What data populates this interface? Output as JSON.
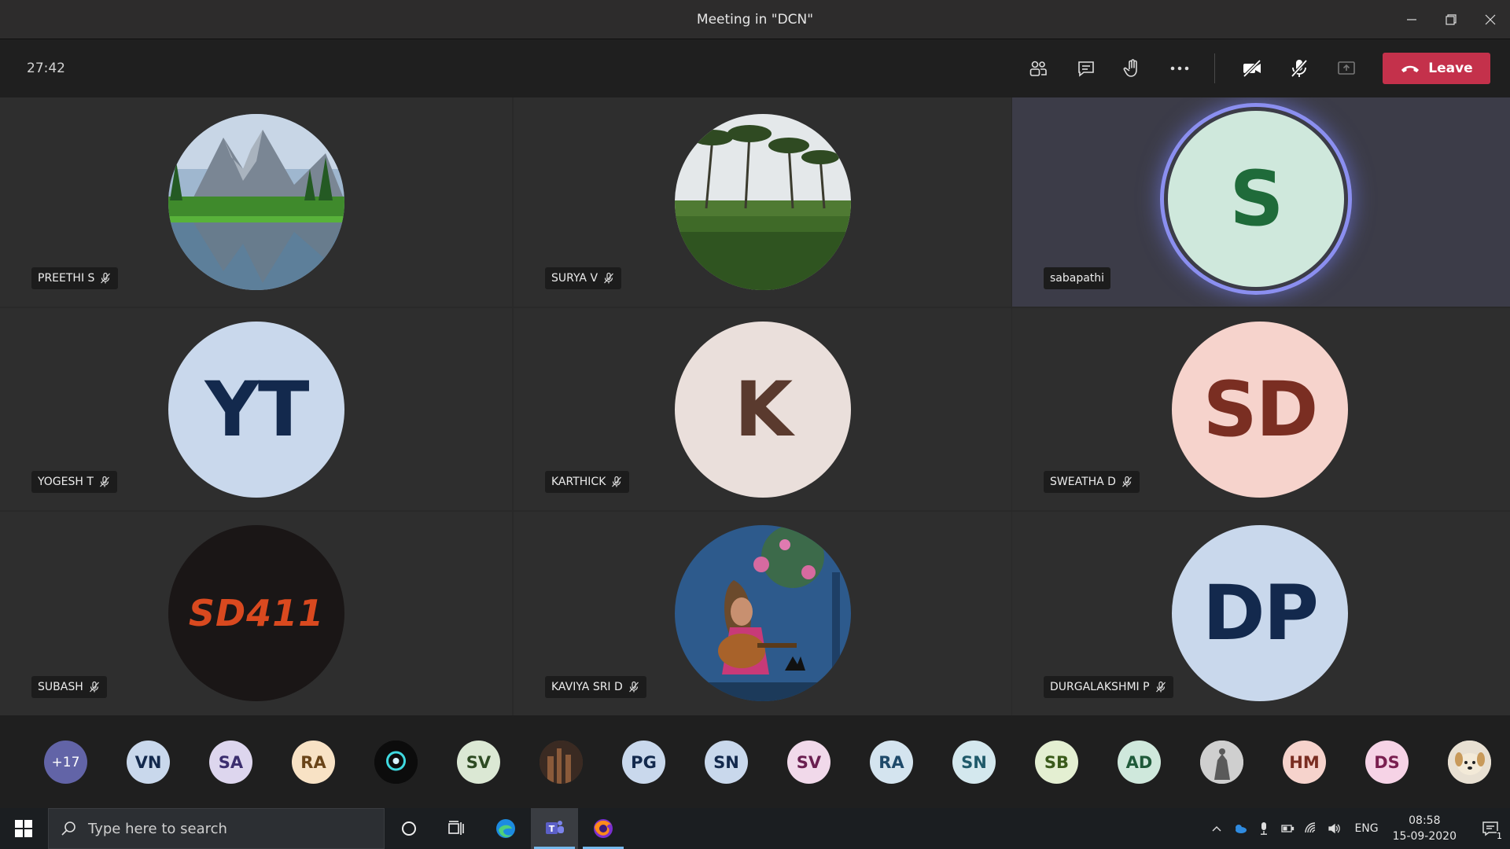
{
  "window": {
    "title": "Meeting in \"DCN\""
  },
  "toolbar": {
    "timer": "27:42",
    "leave_label": "Leave"
  },
  "tiles": [
    {
      "name": "PREETHI S",
      "muted": true
    },
    {
      "name": "SURYA V",
      "muted": true
    },
    {
      "name": "sabapathi",
      "muted": false,
      "initials": "S"
    },
    {
      "name": "YOGESH T",
      "muted": true,
      "initials": "YT"
    },
    {
      "name": "KARTHICK",
      "muted": true,
      "initials": "K"
    },
    {
      "name": "SWEATHA D",
      "muted": true,
      "initials": "SD"
    },
    {
      "name": "SUBASH",
      "muted": true,
      "logo_text": "SD411"
    },
    {
      "name": "KAVIYA SRI D",
      "muted": true
    },
    {
      "name": "DURGALAKSHMI P",
      "muted": true,
      "initials": "DP"
    }
  ],
  "strip": [
    {
      "label": "+17"
    },
    {
      "label": "VN"
    },
    {
      "label": "SA"
    },
    {
      "label": "RA"
    },
    {
      "label": ""
    },
    {
      "label": "SV"
    },
    {
      "label": ""
    },
    {
      "label": "PG"
    },
    {
      "label": "SN"
    },
    {
      "label": "SV"
    },
    {
      "label": "RA"
    },
    {
      "label": "SN"
    },
    {
      "label": "SB"
    },
    {
      "label": "AD"
    },
    {
      "label": ""
    },
    {
      "label": "HM"
    },
    {
      "label": "DS"
    },
    {
      "label": ""
    }
  ],
  "taskbar": {
    "search_placeholder": "Type here to search",
    "lang": "ENG",
    "time": "08:58",
    "date": "15-09-2020",
    "notifications": "1"
  },
  "colors": {
    "leave": "#c4314b",
    "speaking_ring": "#8b8ff0",
    "accent": "#6264a7"
  }
}
